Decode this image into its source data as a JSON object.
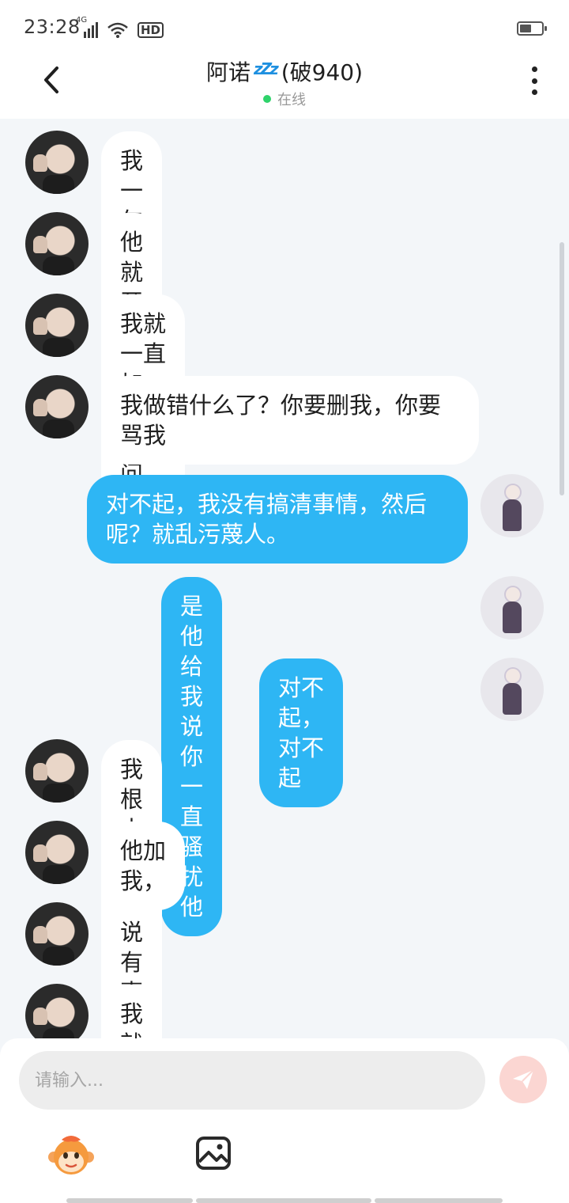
{
  "status_bar": {
    "time": "23:28",
    "network": "4G",
    "hd": "HD"
  },
  "header": {
    "title_name": "阿诺",
    "title_zzz": "zZz",
    "title_suffix": "(破940)",
    "status": "在线",
    "status_color": "#2fd36b",
    "back_icon": "chevron-left-icon",
    "more_icon": "vertical-dots-icon"
  },
  "colors": {
    "outgoing_bubble": "#2eb6f4",
    "incoming_bubble": "#ffffff",
    "background": "#f3f6f9",
    "send_button": "#fbd6d2"
  },
  "messages": [
    {
      "side": "in",
      "text": "我一句话都没跟他说"
    },
    {
      "side": "in",
      "text": "他就开始删我"
    },
    {
      "side": "in",
      "text": "我就一直加他，我想问"
    },
    {
      "side": "in",
      "text": "我做错什么了？你要删我，你要\n骂我"
    },
    {
      "side": "out",
      "text": "对不起，我没有搞清事情，然后\n呢？就乱污蔑人。"
    },
    {
      "side": "out",
      "text": "是他给我说你一直骚扰他"
    },
    {
      "side": "out",
      "text": "对不起，对不起"
    },
    {
      "side": "in",
      "text": "我根本没有骚扰她"
    },
    {
      "side": "in",
      "text": "他加我，"
    },
    {
      "side": "in",
      "text": "说有事儿找我"
    },
    {
      "side": "in",
      "text": "我就同意了"
    }
  ],
  "composer": {
    "placeholder": "请输入...",
    "send_icon": "paper-plane-icon",
    "emoji_icon": "monkey-emoji-icon",
    "image_icon": "image-icon"
  }
}
